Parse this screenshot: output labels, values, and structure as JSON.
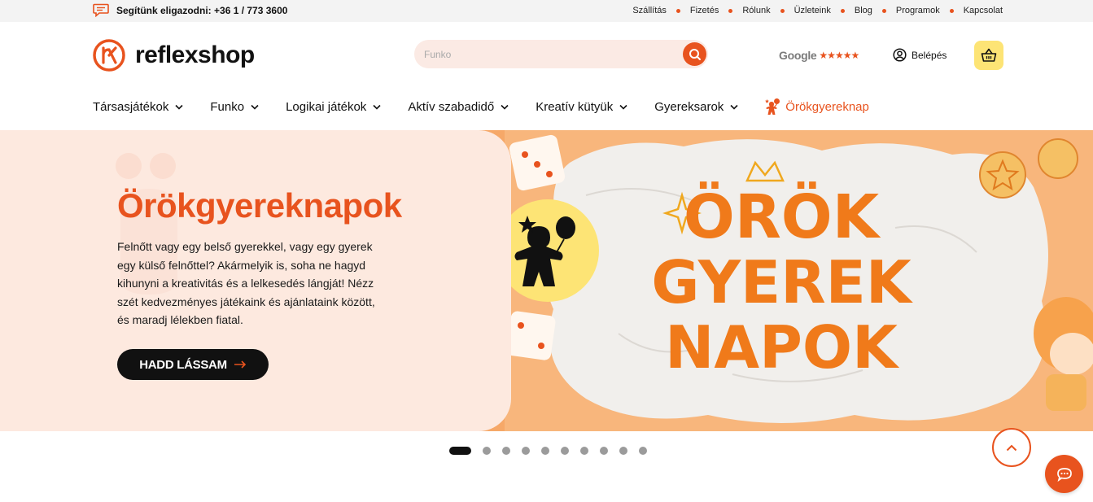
{
  "topbar": {
    "help_text": "Segítünk eligazodni: +36 1 / 773 3600",
    "links": [
      "Szállítás",
      "Fizetés",
      "Rólunk",
      "Üzleteink",
      "Blog",
      "Programok",
      "Kapcsolat"
    ]
  },
  "header": {
    "logo_text": "reflexshop",
    "search_placeholder": "Funko",
    "google_label": "Google",
    "google_stars": "★★★★★",
    "login_label": "Belépés"
  },
  "nav": {
    "items": [
      "Társasjátékok",
      "Funko",
      "Logikai játékok",
      "Aktív szabadidő",
      "Kreatív kütyük",
      "Gyereksarok"
    ],
    "special": "Örökgyereknap"
  },
  "hero": {
    "title": "Örökgyereknapok",
    "text": "Felnőtt vagy egy belső gyerekkel, vagy egy gyerek egy külső felnőttel? Akármelyik is, soha ne hagyd kihunyni a kreativitás és a lelkesedés lángját! Nézz szét kedvezményes játékaink és ajánlataink között, és maradj lélekben fiatal.",
    "cta_label": "HADD LÁSSAM",
    "art_lines": [
      "ÖRÖK",
      "GYEREK",
      "NAPOK"
    ]
  },
  "slider": {
    "count": 10,
    "active": 1
  },
  "colors": {
    "accent": "#e8531e",
    "yellow": "#fde475",
    "card_bg": "#fde9df"
  }
}
